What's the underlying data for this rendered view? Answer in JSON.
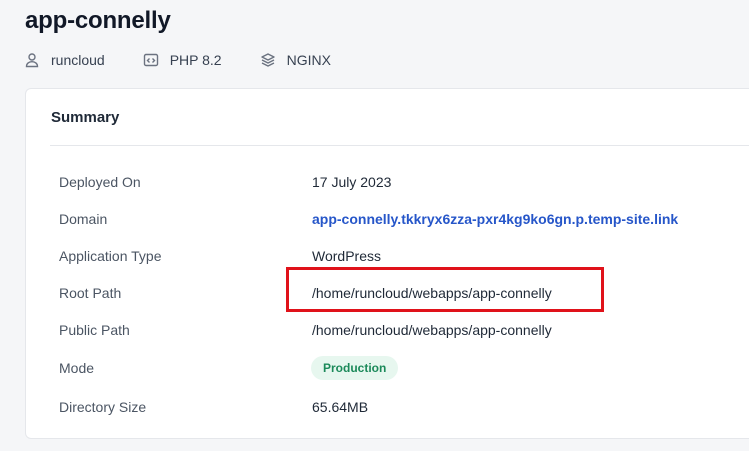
{
  "app": {
    "title": "app-connelly"
  },
  "meta": {
    "user": {
      "label": "runcloud",
      "icon": "user-icon"
    },
    "php": {
      "label": "PHP 8.2",
      "icon": "code-window-icon"
    },
    "server": {
      "label": "NGINX",
      "icon": "layers-icon"
    }
  },
  "summary": {
    "title": "Summary",
    "rows": [
      {
        "label": "Deployed On",
        "value": "17 July 2023"
      },
      {
        "label": "Domain",
        "value": "app-connelly.tkkryx6zza-pxr4kg9ko6gn.p.temp-site.link"
      },
      {
        "label": "Application Type",
        "value": "WordPress"
      },
      {
        "label": "Root Path",
        "value": "/home/runcloud/webapps/app-connelly"
      },
      {
        "label": "Public Path",
        "value": "/home/runcloud/webapps/app-connelly"
      },
      {
        "label": "Mode",
        "value": "Production"
      },
      {
        "label": "Directory Size",
        "value": "65.64MB"
      }
    ]
  },
  "colors": {
    "link": "#2656c9",
    "badge_bg": "#e7f7ef",
    "badge_text": "#1c8a5a",
    "highlight": "#e0121a"
  }
}
